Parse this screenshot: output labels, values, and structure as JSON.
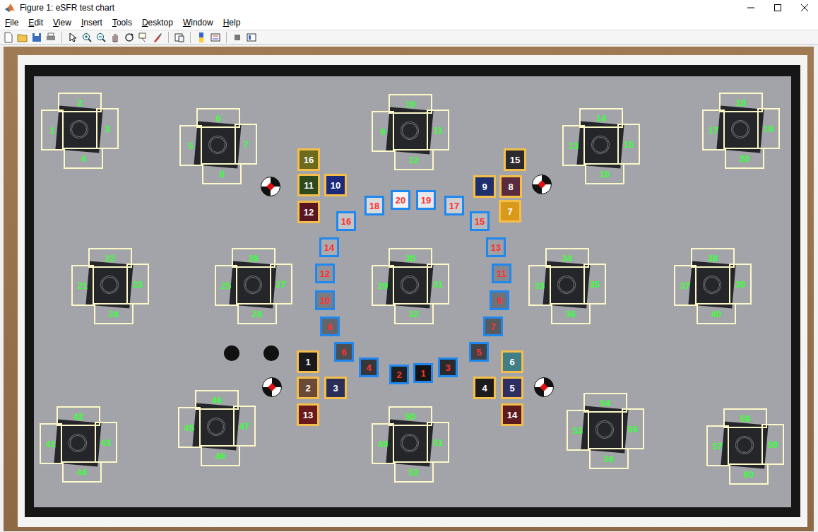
{
  "window": {
    "title": "Figure 1: eSFR test chart"
  },
  "menu": [
    "File",
    "Edit",
    "View",
    "Insert",
    "Tools",
    "Desktop",
    "Window",
    "Help"
  ],
  "figure": {
    "slanted_edge_rois": [
      {
        "label": "1"
      },
      {
        "label": "2"
      },
      {
        "label": "3"
      },
      {
        "label": "4"
      },
      {
        "label": "5"
      },
      {
        "label": "6"
      },
      {
        "label": "7"
      },
      {
        "label": "8"
      },
      {
        "label": "9"
      },
      {
        "label": "10"
      },
      {
        "label": "11"
      },
      {
        "label": "12"
      },
      {
        "label": "13"
      },
      {
        "label": "14"
      },
      {
        "label": "15"
      },
      {
        "label": "16"
      },
      {
        "label": "17"
      },
      {
        "label": "18"
      },
      {
        "label": "19"
      },
      {
        "label": "20"
      },
      {
        "label": "21"
      },
      {
        "label": "22"
      },
      {
        "label": "23"
      },
      {
        "label": "24"
      },
      {
        "label": "25"
      },
      {
        "label": "26"
      },
      {
        "label": "27"
      },
      {
        "label": "28"
      },
      {
        "label": "29"
      },
      {
        "label": "30"
      },
      {
        "label": "31"
      },
      {
        "label": "32"
      },
      {
        "label": "33"
      },
      {
        "label": "34"
      },
      {
        "label": "35"
      },
      {
        "label": "36"
      },
      {
        "label": "37"
      },
      {
        "label": "38"
      },
      {
        "label": "39"
      },
      {
        "label": "40"
      },
      {
        "label": "41"
      },
      {
        "label": "42"
      },
      {
        "label": "43"
      },
      {
        "label": "44"
      },
      {
        "label": "45"
      },
      {
        "label": "46"
      },
      {
        "label": "47"
      },
      {
        "label": "48"
      },
      {
        "label": "49"
      },
      {
        "label": "50"
      },
      {
        "label": "51"
      },
      {
        "label": "52"
      },
      {
        "label": "53"
      },
      {
        "label": "54"
      },
      {
        "label": "55"
      },
      {
        "label": "56"
      },
      {
        "label": "57"
      },
      {
        "label": "58"
      },
      {
        "label": "59"
      },
      {
        "label": "60"
      }
    ],
    "gray_rois": [
      {
        "label": "1"
      },
      {
        "label": "2"
      },
      {
        "label": "3"
      },
      {
        "label": "4"
      },
      {
        "label": "5"
      },
      {
        "label": "6"
      },
      {
        "label": "7"
      },
      {
        "label": "8"
      },
      {
        "label": "9"
      },
      {
        "label": "10"
      },
      {
        "label": "11"
      },
      {
        "label": "12"
      },
      {
        "label": "13"
      },
      {
        "label": "14"
      },
      {
        "label": "15"
      },
      {
        "label": "16"
      },
      {
        "label": "17"
      },
      {
        "label": "18"
      },
      {
        "label": "19"
      },
      {
        "label": "20"
      }
    ],
    "color_rois": [
      {
        "label": "1",
        "color": "#1a1a1c"
      },
      {
        "label": "2",
        "color": "#6a4a36"
      },
      {
        "label": "3",
        "color": "#2a2f58"
      },
      {
        "label": "4",
        "color": "#1c1c1c"
      },
      {
        "label": "5",
        "color": "#2d2e62"
      },
      {
        "label": "6",
        "color": "#3f7f85"
      },
      {
        "label": "7",
        "color": "#d99a1c"
      },
      {
        "label": "8",
        "color": "#5a2a3e"
      },
      {
        "label": "9",
        "color": "#1e2f6e"
      },
      {
        "label": "10",
        "color": "#1b2a7a"
      },
      {
        "label": "11",
        "color": "#2d4a1f"
      },
      {
        "label": "12",
        "color": "#5a1620"
      },
      {
        "label": "13",
        "color": "#6a1a1a"
      },
      {
        "label": "14",
        "color": "#5e1b1e"
      },
      {
        "label": "15",
        "color": "#2d2a2e"
      },
      {
        "label": "16",
        "color": "#6b6a1d"
      }
    ]
  }
}
